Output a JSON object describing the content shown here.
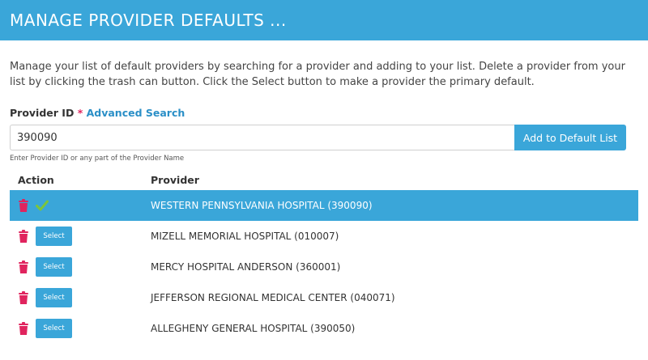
{
  "header": {
    "title": "MANAGE PROVIDER DEFAULTS ..."
  },
  "description": "Manage your list of default providers by searching for a provider and adding to your list. Delete a provider from your list by clicking the trash can button. Click the Select button to make a provider the primary default.",
  "form": {
    "label": "Provider ID",
    "required_mark": "*",
    "advanced_search": "Advanced Search",
    "input_value": "390090",
    "add_button": "Add to Default List",
    "hint": "Enter Provider ID or any part of the Provider Name"
  },
  "table": {
    "headers": {
      "action": "Action",
      "provider": "Provider"
    },
    "select_label": "Select",
    "rows": [
      {
        "provider": "WESTERN PENNSYLVANIA HOSPITAL (390090)",
        "selected": true
      },
      {
        "provider": "MIZELL MEMORIAL HOSPITAL (010007)",
        "selected": false
      },
      {
        "provider": "MERCY HOSPITAL ANDERSON (360001)",
        "selected": false
      },
      {
        "provider": "JEFFERSON REGIONAL MEDICAL CENTER (040071)",
        "selected": false
      },
      {
        "provider": "ALLEGHENY GENERAL HOSPITAL (390050)",
        "selected": false
      }
    ]
  },
  "colors": {
    "accent": "#3aa6d9",
    "trash": "#e0245e",
    "check": "#7cc53a"
  },
  "icons": {
    "trash": "trash-icon",
    "check": "checkmark-icon"
  }
}
